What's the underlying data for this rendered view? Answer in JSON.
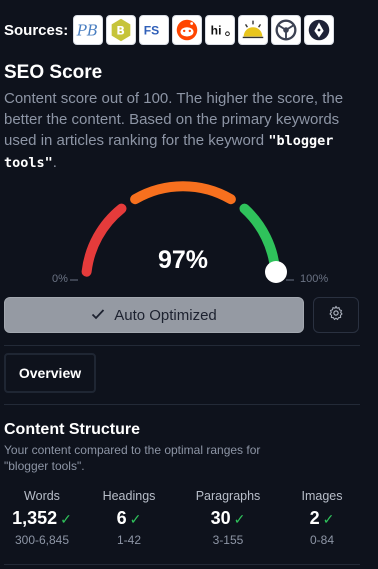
{
  "sources": {
    "label": "Sources:",
    "icons": [
      "pb-logo-icon",
      "bitcoin-style-icon",
      "fs-logo-icon",
      "reddit-icon",
      "hi-logo-icon",
      "sunrise-logo-icon",
      "steering-logo-icon",
      "pen-nib-icon"
    ],
    "fs_text": "FS",
    "pb_text": "PB",
    "hi_text": "hi"
  },
  "seo": {
    "title": "SEO Score",
    "description": "Content score out of 100. The higher the score, the better the content. Based on the primary keywords used in articles ranking for the keyword",
    "keyword": "\"blogger tools\"",
    "period": "."
  },
  "gauge": {
    "score_text": "97%",
    "score_value": 97,
    "min_label": "0%",
    "max_label": "100%",
    "colors": {
      "low": "#e53b3b",
      "mid": "#f7701e",
      "high": "#2fc25b",
      "knob": "#ffffff"
    }
  },
  "actions": {
    "auto_label": "Auto Optimized",
    "settings_icon": "gear-icon"
  },
  "tabs": {
    "overview": "Overview"
  },
  "content_structure": {
    "title": "Content Structure",
    "description": "Your content compared to the optimal ranges for \"blogger tools\".",
    "stats": [
      {
        "label": "Words",
        "value": "1,352",
        "range": "300-6,845"
      },
      {
        "label": "Headings",
        "value": "6",
        "range": "1-42"
      },
      {
        "label": "Paragraphs",
        "value": "30",
        "range": "3-155"
      },
      {
        "label": "Images",
        "value": "2",
        "range": "0-84"
      }
    ],
    "check_glyph": "✓"
  }
}
